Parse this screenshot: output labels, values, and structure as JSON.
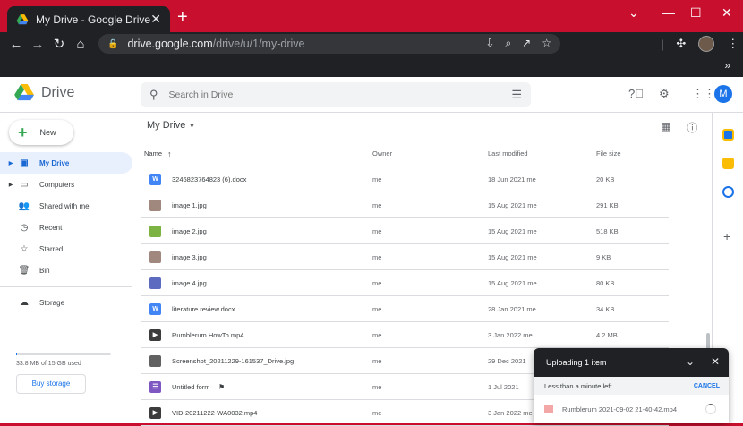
{
  "browser": {
    "tab_title": "My Drive - Google Drive",
    "tab_close": "✕",
    "new_tab": "+",
    "url_host": "drive.google.com",
    "url_path": "/drive/u/1/my-drive",
    "avatar_letter": "M",
    "bookmarks_more": "»"
  },
  "drive": {
    "app_name": "Drive",
    "search_placeholder": "Search in Drive",
    "new_label": "New",
    "breadcrumb": "My Drive",
    "sidebar": [
      {
        "label": "My Drive",
        "icon": "my-drive-icon",
        "active": true,
        "arrow": true
      },
      {
        "label": "Computers",
        "icon": "computers-icon",
        "active": false,
        "arrow": true
      },
      {
        "label": "Shared with me",
        "icon": "shared-icon",
        "active": false,
        "arrow": false
      },
      {
        "label": "Recent",
        "icon": "recent-icon",
        "active": false,
        "arrow": false
      },
      {
        "label": "Starred",
        "icon": "star-icon",
        "active": false,
        "arrow": false
      },
      {
        "label": "Bin",
        "icon": "bin-icon",
        "active": false,
        "arrow": false
      }
    ],
    "storage_label": "Storage",
    "storage_used": "33.8 MB of 15 GB used",
    "buy_storage": "Buy storage",
    "columns": {
      "name": "Name",
      "owner": "Owner",
      "modified": "Last modified",
      "size": "File size"
    },
    "files": [
      {
        "name": "3246823764823 (6).docx",
        "type": "word",
        "owner": "me",
        "modified": "18 Jun 2021 me",
        "size": "20 KB"
      },
      {
        "name": "image 1.jpg",
        "type": "image",
        "owner": "me",
        "modified": "15 Aug 2021 me",
        "size": "291 KB"
      },
      {
        "name": "image 2.jpg",
        "type": "image-green",
        "owner": "me",
        "modified": "15 Aug 2021 me",
        "size": "518 KB"
      },
      {
        "name": "image 3.jpg",
        "type": "image",
        "owner": "me",
        "modified": "15 Aug 2021 me",
        "size": "9 KB"
      },
      {
        "name": "image 4.jpg",
        "type": "image-blue",
        "owner": "me",
        "modified": "15 Aug 2021 me",
        "size": "80 KB"
      },
      {
        "name": "literature review.docx",
        "type": "word",
        "owner": "me",
        "modified": "28 Jan 2021 me",
        "size": "34 KB"
      },
      {
        "name": "Rumblerum.HowTo.mp4",
        "type": "video",
        "owner": "me",
        "modified": "3 Jan 2022 me",
        "size": "4.2 MB"
      },
      {
        "name": "Screenshot_20211229-161537_Drive.jpg",
        "type": "image-dark",
        "owner": "me",
        "modified": "29 Dec 2021",
        "size": ""
      },
      {
        "name": "Untitled form",
        "type": "form",
        "owner": "me",
        "modified": "1 Jul 2021",
        "size": ""
      },
      {
        "name": "VID-20211222-WA0032.mp4",
        "type": "video",
        "owner": "me",
        "modified": "3 Jan 2022 me",
        "size": ""
      }
    ]
  },
  "upload": {
    "title": "Uploading 1 item",
    "status": "Less than a minute left",
    "cancel": "CANCEL",
    "file_name": "Rumblerum 2021-09-02 21-40-42.mp4"
  },
  "colors": {
    "chrome_frame": "#c8102e",
    "toolbar": "#202124",
    "accent": "#1a73e8",
    "active_nav_bg": "#e8f0fe"
  }
}
